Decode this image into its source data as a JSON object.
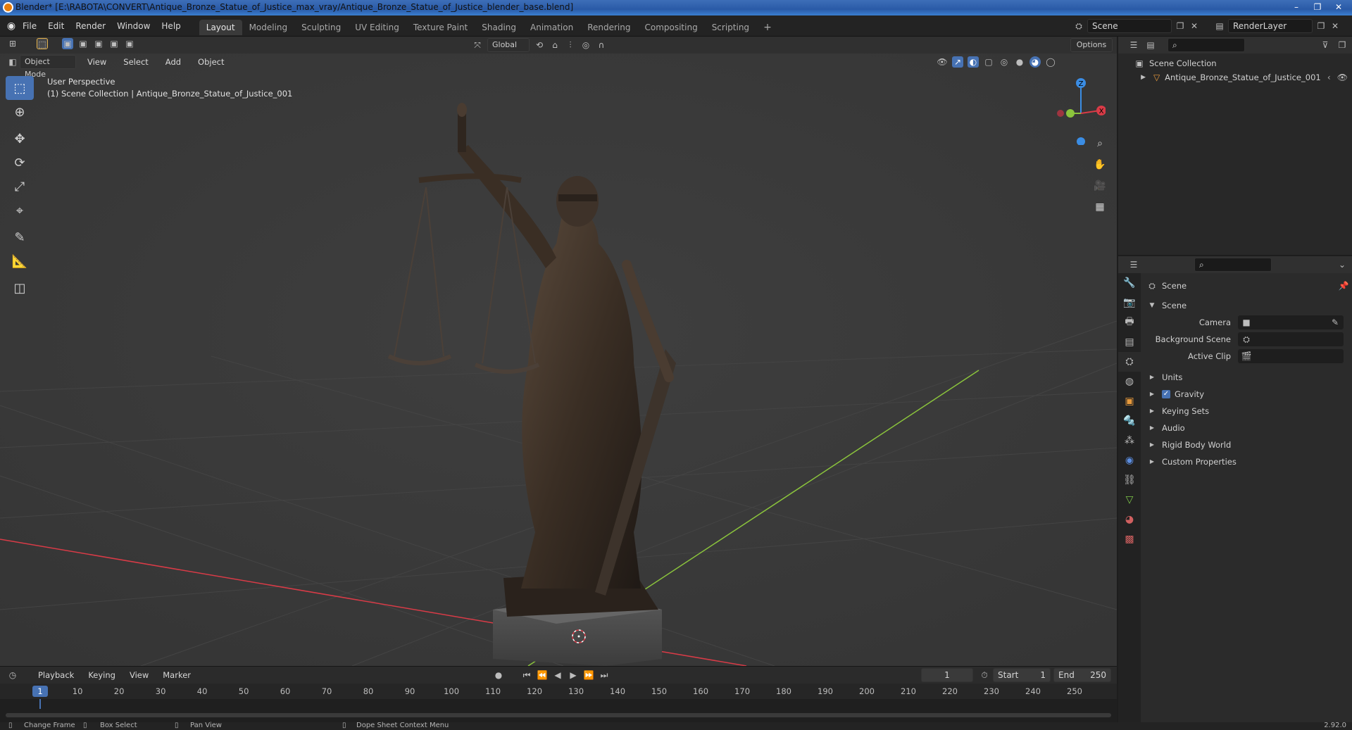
{
  "window": {
    "title": "Blender* [E:\\RABOTA\\CONVERT\\Antique_Bronze_Statue_of_Justice_max_vray/Antique_Bronze_Statue_of_Justice_blender_base.blend]",
    "controls": [
      "–",
      "❐",
      "✕"
    ]
  },
  "menubar": {
    "items": [
      "File",
      "Edit",
      "Render",
      "Window",
      "Help"
    ],
    "workspaces": [
      "Layout",
      "Modeling",
      "Sculpting",
      "UV Editing",
      "Texture Paint",
      "Shading",
      "Animation",
      "Rendering",
      "Compositing",
      "Scripting"
    ],
    "active_workspace": "Layout",
    "add_tab": "+",
    "scene_name": "Scene",
    "view_layer": "RenderLayer"
  },
  "viewport_header": {
    "orientation": "Global",
    "options": "Options",
    "mode": "Object Mode",
    "menus": [
      "View",
      "Select",
      "Add",
      "Object"
    ]
  },
  "viewport": {
    "perspective_label": "User Perspective",
    "collection_label": "(1) Scene Collection | Antique_Bronze_Statue_of_Justice_001",
    "gizmo_axes": [
      "X",
      "Y",
      "Z"
    ],
    "tools": [
      "select-box",
      "cursor",
      "move",
      "rotate",
      "scale",
      "transform",
      "annotate",
      "measure",
      "add-cube"
    ],
    "nav_buttons": [
      "zoom",
      "pan",
      "camera",
      "ortho"
    ],
    "background": "#3a3a3a",
    "statue_color": "#3b3027"
  },
  "outliner": {
    "root": "Scene Collection",
    "items": [
      {
        "name": "Antique_Bronze_Statue_of_Justice_001",
        "visible": true
      }
    ]
  },
  "properties": {
    "context_title": "Scene",
    "panel_title": "Scene",
    "fields": [
      {
        "label": "Camera",
        "value": ""
      },
      {
        "label": "Background Scene",
        "value": ""
      },
      {
        "label": "Active Clip",
        "value": ""
      }
    ],
    "subpanels": [
      {
        "label": "Units",
        "checkbox": false
      },
      {
        "label": "Gravity",
        "checkbox": true
      },
      {
        "label": "Keying Sets",
        "checkbox": false
      },
      {
        "label": "Audio",
        "checkbox": false
      },
      {
        "label": "Rigid Body World",
        "checkbox": false
      },
      {
        "label": "Custom Properties",
        "checkbox": false
      }
    ]
  },
  "timeline": {
    "menus": [
      "Playback",
      "Keying",
      "View",
      "Marker"
    ],
    "current_frame": "1",
    "start_label": "Start",
    "start_value": "1",
    "end_label": "End",
    "end_value": "250",
    "ruler": [
      "1",
      "10",
      "20",
      "30",
      "40",
      "50",
      "60",
      "70",
      "80",
      "90",
      "100",
      "110",
      "120",
      "130",
      "140",
      "150",
      "160",
      "170",
      "180",
      "190",
      "200",
      "210",
      "220",
      "230",
      "240",
      "250"
    ]
  },
  "statusbar": {
    "hints": [
      "Change Frame",
      "Box Select",
      "Pan View",
      "Dope Sheet Context Menu"
    ],
    "version": "2.92.0"
  },
  "colors": {
    "accent": "#4772b3",
    "x_axis": "#d93b47",
    "y_axis": "#8bc43c",
    "z_axis": "#3b8de4"
  }
}
